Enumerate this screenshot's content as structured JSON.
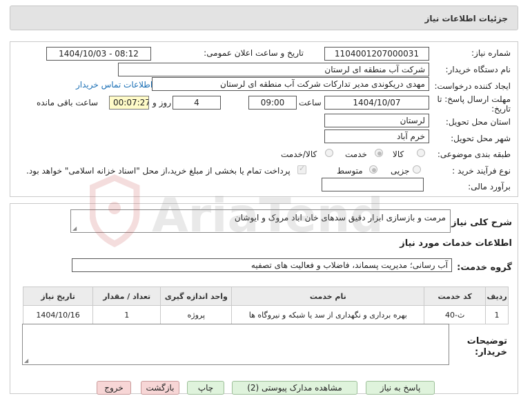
{
  "page": {
    "title": "جزئیات اطلاعات نیاز"
  },
  "form": {
    "need_number_label": "شماره نیاز:",
    "need_number_value": "1104001207000031",
    "announce_label": "تاریخ و ساعت اعلان عمومی:",
    "announce_value": "1404/10/03 - 08:12",
    "buyer_org_label": "نام دستگاه خریدار:",
    "buyer_org_value": "شرکت آب منطقه ای لرستان",
    "creator_label": "ایجاد کننده درخواست:",
    "creator_value": "مهدی دریکوندی مدیر تدارکات شرکت آب منطقه ای لرستان",
    "contact_link": "اطلاعات تماس خریدار",
    "deadline_label_1": "مهلت ارسال پاسخ: تا",
    "deadline_label_2": "تاریخ:",
    "deadline_date": "1404/10/07",
    "time_label": "ساعت",
    "deadline_time": "09:00",
    "days_value": "4",
    "days_label": "روز و",
    "remaining_timer": "00:07:27",
    "remaining_label": "ساعت باقی مانده",
    "province_label": "استان محل تحویل:",
    "province_value": "لرستان",
    "city_label": "شهر محل تحویل:",
    "city_value": "خرم آباد",
    "category_label": "طبقه بندی موضوعی:",
    "category_options": [
      "کالا",
      "خدمت",
      "کالا/خدمت"
    ],
    "category_selected": "خدمت",
    "process_label": "نوع فرآیند خرید :",
    "process_options": [
      "جزیی",
      "متوسط"
    ],
    "process_selected": "متوسط",
    "payment_note": "پرداخت تمام یا بخشی از مبلغ خرید،از محل \"اسناد خزانه اسلامی\" خواهد بود.",
    "estimate_label": "برآورد مالی:",
    "estimate_value": ""
  },
  "description": {
    "label": "شرح کلی نیاز:",
    "value": "مرمت و بازسازی ابزار دقیق سدهای خان اباد مروک و ایوشان"
  },
  "services_section": {
    "title": "اطلاعات خدمات مورد نیاز",
    "group_label": "گروه خدمت:",
    "group_value": "آب رسانی؛ مدیریت پسماند، فاضلاب و فعالیت های تصفیه"
  },
  "table": {
    "headers": [
      "ردیف",
      "کد خدمت",
      "نام خدمت",
      "واحد اندازه گیری",
      "تعداد / مقدار",
      "تاریخ نیاز"
    ],
    "rows": [
      [
        "1",
        "ث-40",
        "بهره برداری و نگهداری از سد یا شبکه و نیروگاه ها",
        "پروژه",
        "1",
        "1404/10/16"
      ]
    ]
  },
  "buyer_notes": {
    "label_1": "توضیحات",
    "label_2": "خریدار:",
    "value": ""
  },
  "buttons": {
    "reply": "پاسخ به نیاز",
    "attachments": "مشاهده مدارک پیوستی (2)",
    "print": "چاپ",
    "back": "بازگشت",
    "exit": "خروج"
  },
  "watermark": {
    "text": "AriaTender.neT"
  },
  "colors": {
    "header_bg": "#e3e3e3",
    "link": "#1a6fb5",
    "timer_bg": "#fffbc8",
    "green_button": "#dff3dc",
    "pink_button": "#f7d6d6"
  }
}
